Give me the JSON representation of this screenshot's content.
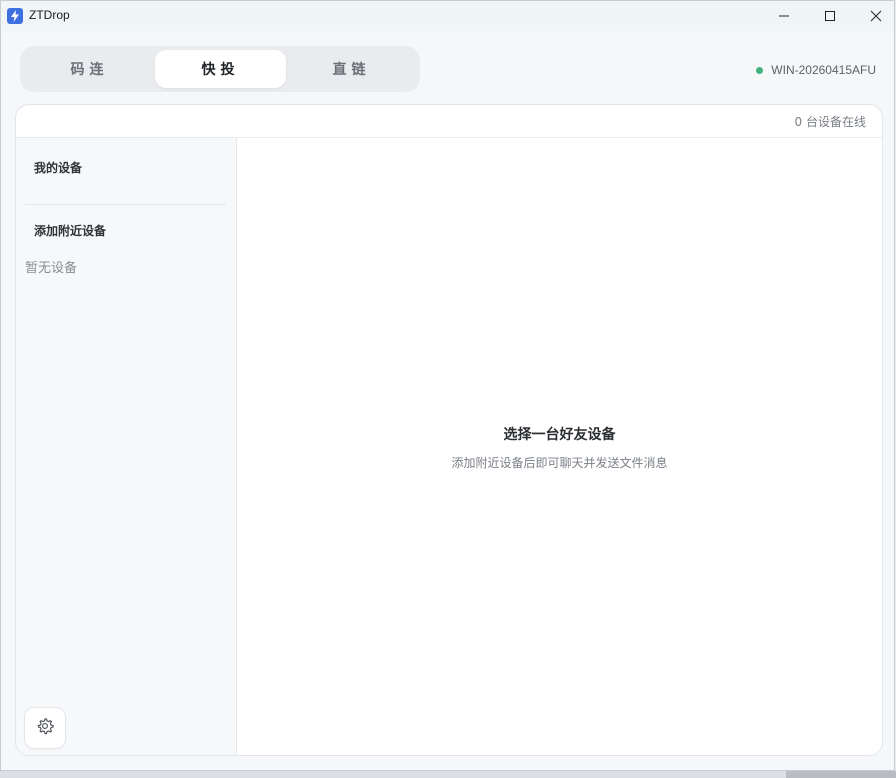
{
  "window": {
    "title": "ZTDrop"
  },
  "tabs": [
    {
      "label": "码连"
    },
    {
      "label": "快投"
    },
    {
      "label": "直链"
    }
  ],
  "host": {
    "name": "WIN-20260415AFU",
    "status_color": "#3fb27f"
  },
  "panel": {
    "online_count": "0 台设备在线"
  },
  "sidebar": {
    "my_devices": "我的设备",
    "add_nearby": "添加附近设备",
    "empty": "暂无设备"
  },
  "main": {
    "title": "选择一台好友设备",
    "subtitle": "添加附近设备后即可聊天并发送文件消息"
  },
  "icons": {
    "app": "lightning-icon",
    "minimize": "minimize-icon",
    "maximize": "maximize-icon",
    "close": "close-icon",
    "settings": "gear-icon"
  },
  "colors": {
    "accent": "#3d6fe0",
    "online_dot": "#3fb27f"
  }
}
